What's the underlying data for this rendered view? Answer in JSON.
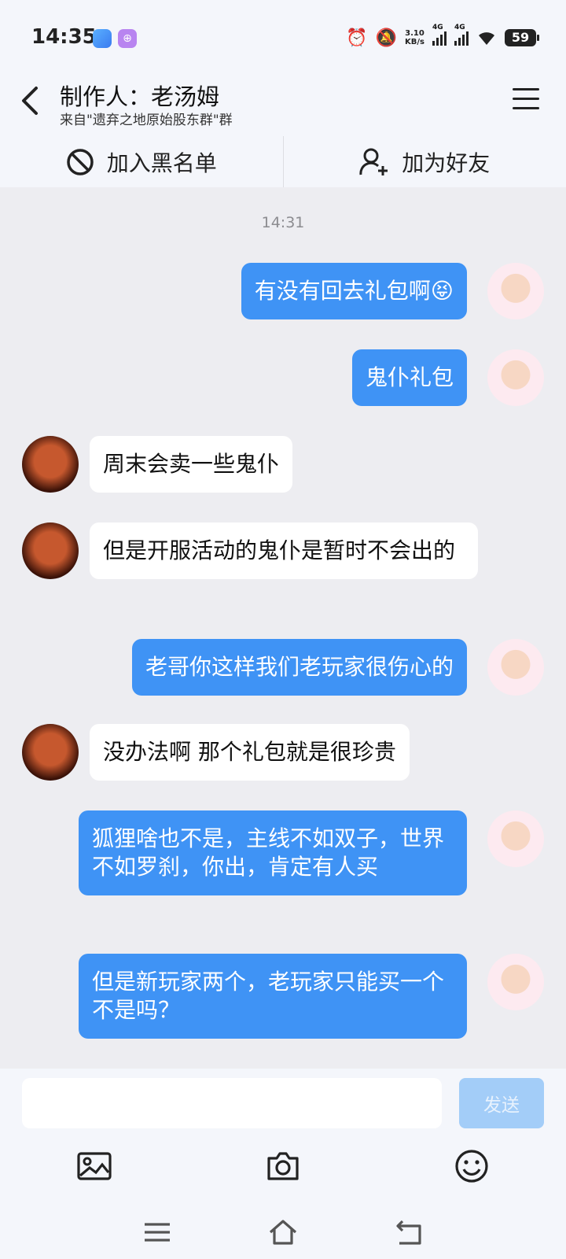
{
  "status": {
    "time": "14:35",
    "net_speed_top": "3.10",
    "net_speed_unit": "KB/s",
    "sig1": "4G",
    "sig2": "4G",
    "battery": "59"
  },
  "header": {
    "title": "制作人：老汤姆",
    "subtitle": "来自\"遗弃之地原始股东群\"群"
  },
  "actions": {
    "blacklist": "加入黑名单",
    "add_friend": "加为好友"
  },
  "chat": {
    "timestamp": "14:31",
    "messages": [
      {
        "from": "me",
        "text": "有没有回去礼包啊😝"
      },
      {
        "from": "me",
        "text": "鬼仆礼包"
      },
      {
        "from": "them",
        "text": "周末会卖一些鬼仆"
      },
      {
        "from": "them",
        "text": "但是开服活动的鬼仆是暂时不会出的"
      },
      {
        "from": "me",
        "text": "老哥你这样我们老玩家很伤心的"
      },
      {
        "from": "them",
        "text": "没办法啊 那个礼包就是很珍贵"
      },
      {
        "from": "me",
        "text": "狐狸啥也不是，主线不如双子，世界不如罗刹，你出，肯定有人买"
      },
      {
        "from": "me",
        "text": "但是新玩家两个，老玩家只能买一个不是吗？"
      }
    ]
  },
  "input": {
    "value": "",
    "send_label": "发送"
  },
  "icons": {
    "image": "image-icon",
    "camera": "camera-icon",
    "emoji": "emoji-icon"
  },
  "colors": {
    "my_bubble": "#3f93f5",
    "their_bubble": "#ffffff",
    "send_disabled": "#a3cdf8"
  }
}
